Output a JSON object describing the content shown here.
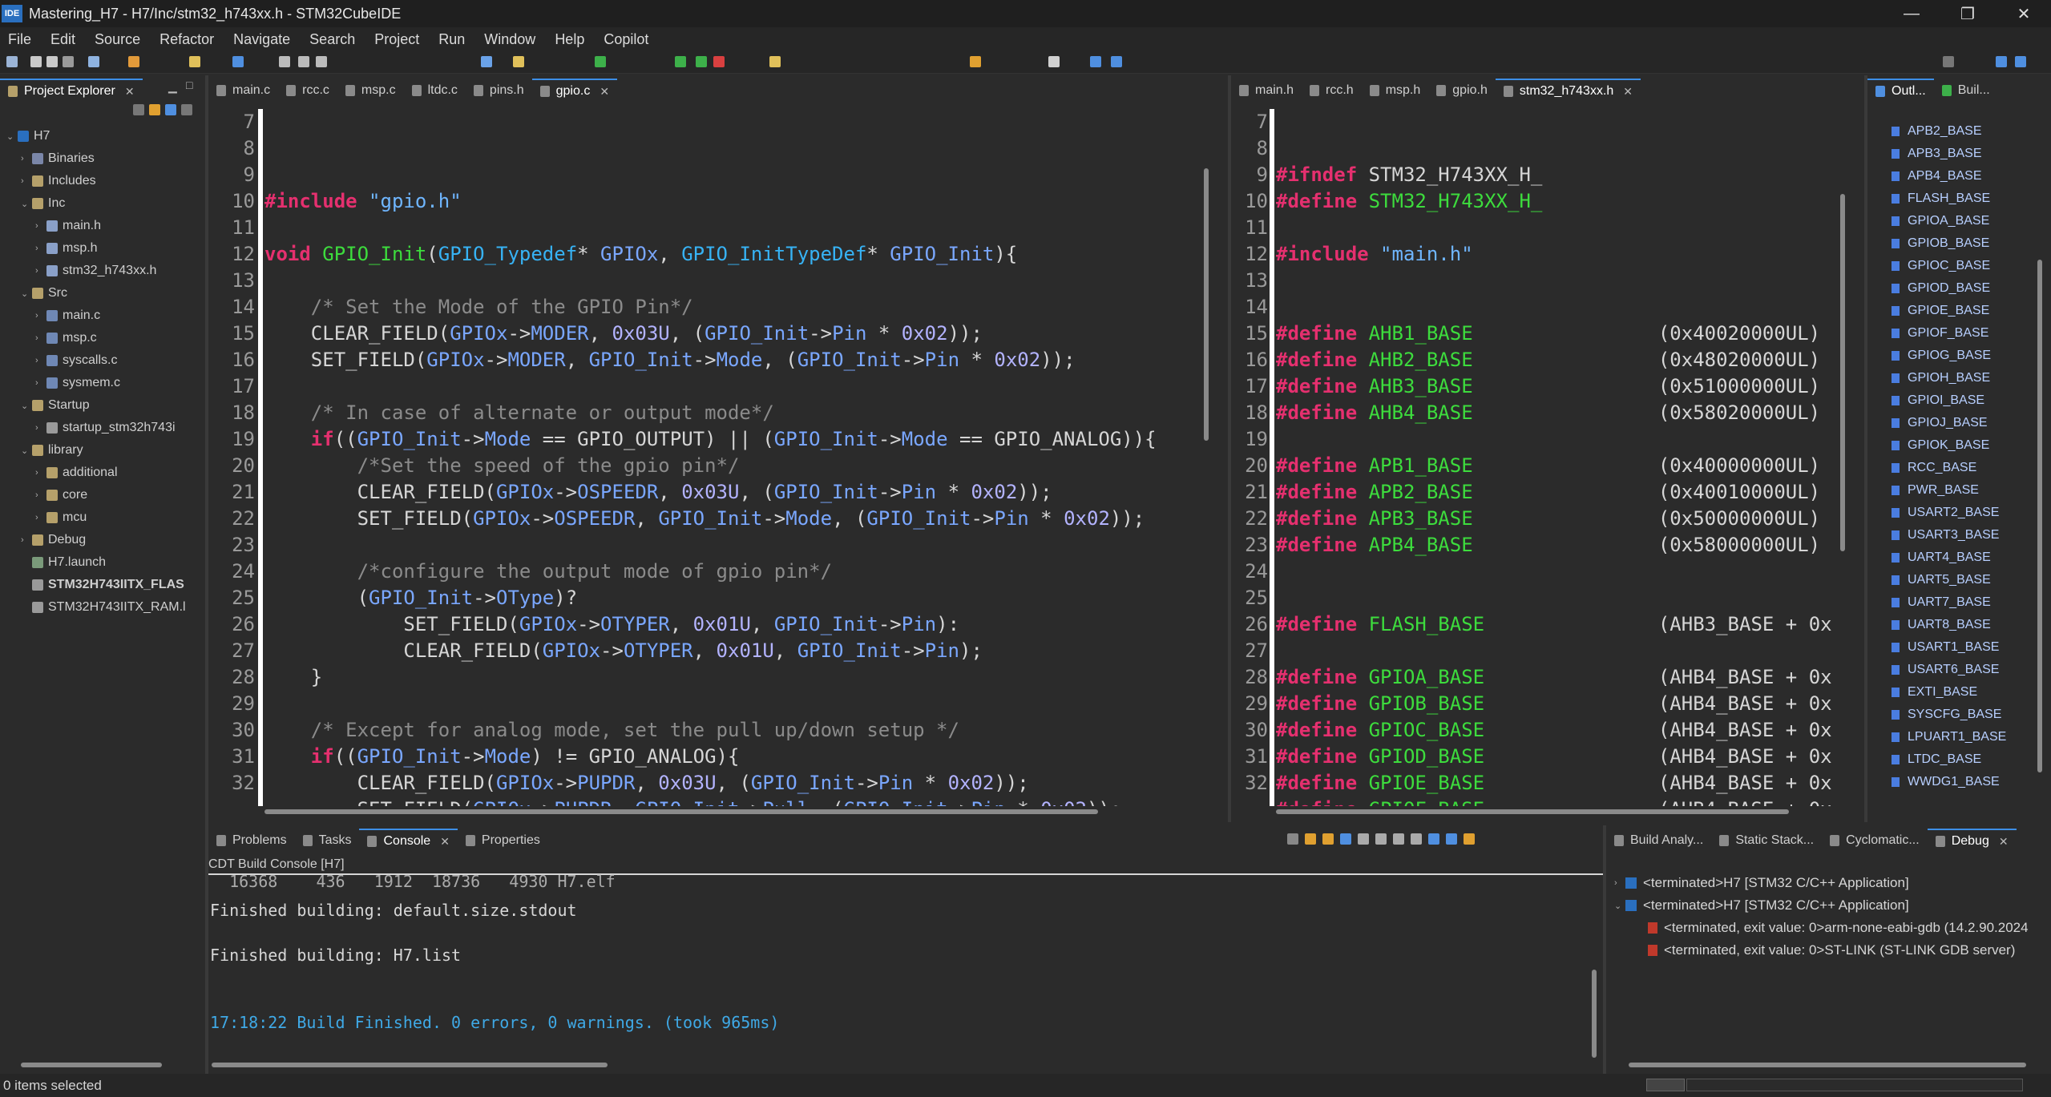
{
  "window": {
    "icon_label": "IDE",
    "title": "Mastering_H7 - H7/Inc/stm32_h743xx.h - STM32CubeIDE"
  },
  "menu": [
    "File",
    "Edit",
    "Source",
    "Refactor",
    "Navigate",
    "Search",
    "Project",
    "Run",
    "Window",
    "Help",
    "Copilot"
  ],
  "project_explorer": {
    "tab_label": "Project Explorer",
    "items": [
      {
        "label": "H7",
        "indent": 0,
        "expanded": true,
        "icon": "project-icon"
      },
      {
        "label": "Binaries",
        "indent": 1,
        "expanded": false,
        "icon": "binaries-icon"
      },
      {
        "label": "Includes",
        "indent": 1,
        "expanded": false,
        "icon": "includes-icon"
      },
      {
        "label": "Inc",
        "indent": 1,
        "expanded": true,
        "icon": "folder-icon"
      },
      {
        "label": "main.h",
        "indent": 2,
        "expanded": false,
        "icon": "header-file-icon"
      },
      {
        "label": "msp.h",
        "indent": 2,
        "expanded": false,
        "icon": "header-file-icon"
      },
      {
        "label": "stm32_h743xx.h",
        "indent": 2,
        "expanded": false,
        "icon": "header-file-icon"
      },
      {
        "label": "Src",
        "indent": 1,
        "expanded": true,
        "icon": "folder-icon"
      },
      {
        "label": "main.c",
        "indent": 2,
        "expanded": false,
        "icon": "c-file-icon"
      },
      {
        "label": "msp.c",
        "indent": 2,
        "expanded": false,
        "icon": "c-file-icon"
      },
      {
        "label": "syscalls.c",
        "indent": 2,
        "expanded": false,
        "icon": "c-file-icon"
      },
      {
        "label": "sysmem.c",
        "indent": 2,
        "expanded": false,
        "icon": "c-file-icon"
      },
      {
        "label": "Startup",
        "indent": 1,
        "expanded": true,
        "icon": "folder-icon"
      },
      {
        "label": "startup_stm32h743i",
        "indent": 2,
        "expanded": false,
        "icon": "asm-file-icon"
      },
      {
        "label": "library",
        "indent": 1,
        "expanded": true,
        "icon": "folder-icon"
      },
      {
        "label": "additional",
        "indent": 2,
        "expanded": false,
        "icon": "folder-icon"
      },
      {
        "label": "core",
        "indent": 2,
        "expanded": false,
        "icon": "folder-icon"
      },
      {
        "label": "mcu",
        "indent": 2,
        "expanded": false,
        "icon": "folder-icon"
      },
      {
        "label": "Debug",
        "indent": 1,
        "expanded": false,
        "icon": "folder-icon"
      },
      {
        "label": "H7.launch",
        "indent": 1,
        "expanded": null,
        "icon": "launch-file-icon"
      },
      {
        "label": "STM32H743IITX_FLAS",
        "indent": 1,
        "expanded": null,
        "icon": "linker-file-icon"
      },
      {
        "label": "STM32H743IITX_RAM.l",
        "indent": 1,
        "expanded": null,
        "icon": "linker-file-icon"
      }
    ]
  },
  "left_editor": {
    "tabs": [
      "main.c",
      "rcc.c",
      "msp.c",
      "ltdc.c",
      "pins.h",
      "gpio.c"
    ],
    "active_tab": "gpio.c",
    "line_numbers": [
      "7",
      "8",
      "9",
      "10",
      "11",
      "12",
      "13",
      "14",
      "15",
      "16",
      "17",
      "18",
      "19",
      "20",
      "21",
      "22",
      "23",
      "24",
      "25",
      "26",
      "27",
      "28",
      "29",
      "30",
      "31",
      "32"
    ]
  },
  "right_editor": {
    "tabs": [
      "main.h",
      "rcc.h",
      "msp.h",
      "gpio.h",
      "stm32_h743xx.h"
    ],
    "active_tab": "stm32_h743xx.h",
    "line_numbers": [
      "7",
      "8",
      "9",
      "10",
      "11",
      "12",
      "13",
      "14",
      "15",
      "16",
      "17",
      "18",
      "19",
      "20",
      "21",
      "22",
      "23",
      "24",
      "25",
      "26",
      "27",
      "28",
      "29",
      "30",
      "31",
      "32"
    ]
  },
  "outline": {
    "tabs": [
      "Outl...",
      "Buil..."
    ],
    "items": [
      "APB2_BASE",
      "APB3_BASE",
      "APB4_BASE",
      "FLASH_BASE",
      "GPIOA_BASE",
      "GPIOB_BASE",
      "GPIOC_BASE",
      "GPIOD_BASE",
      "GPIOE_BASE",
      "GPIOF_BASE",
      "GPIOG_BASE",
      "GPIOH_BASE",
      "GPIOI_BASE",
      "GPIOJ_BASE",
      "GPIOK_BASE",
      "RCC_BASE",
      "PWR_BASE",
      "USART2_BASE",
      "USART3_BASE",
      "UART4_BASE",
      "UART5_BASE",
      "UART7_BASE",
      "UART8_BASE",
      "USART1_BASE",
      "USART6_BASE",
      "EXTI_BASE",
      "SYSCFG_BASE",
      "LPUART1_BASE",
      "LTDC_BASE",
      "WWDG1_BASE"
    ]
  },
  "bottom_panel": {
    "tabs": [
      "Problems",
      "Tasks",
      "Console",
      "Properties"
    ],
    "active_tab": "Console",
    "console_title": "CDT Build Console [H7]",
    "lines": [
      "  16368    436   1912  18736   4930 H7.elf",
      "Finished building: default.size.stdout",
      "",
      "Finished building: H7.list",
      "",
      "",
      "17:18:22 Build Finished. 0 errors, 0 warnings. (took 965ms)"
    ]
  },
  "debug_panel": {
    "tabs": [
      "Build Analy...",
      "Static Stack...",
      "Cyclomatic...",
      "Debug"
    ],
    "active_tab": "Debug",
    "items": [
      "<terminated>H7 [STM32 C/C++ Application]",
      "<terminated>H7 [STM32 C/C++ Application]",
      "<terminated, exit value: 0>arm-none-eabi-gdb (14.2.90.2024",
      "<terminated, exit value: 0>ST-LINK (ST-LINK GDB server)"
    ]
  },
  "status": {
    "selection": "0 items selected"
  }
}
